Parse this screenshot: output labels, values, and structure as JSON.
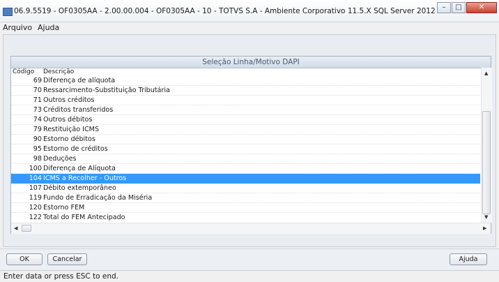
{
  "window": {
    "title": "06.9.5519 - OF0305AA - 2.00.00.004 - OF0305AA - 10 - TOTVS S.A - Ambiente Corporativo 11.5.X SQL Server 2012",
    "minimize_glyph": "–",
    "maximize_glyph": "□",
    "close_glyph": "✕"
  },
  "menu": {
    "items": [
      "Arquivo",
      "Ajuda"
    ]
  },
  "dialog": {
    "title": "Seleção Linha/Motivo DAPI",
    "columns": {
      "code": "Código",
      "desc": "Descrição"
    },
    "rows": [
      {
        "code": "69",
        "desc": "Diferença de alíquota"
      },
      {
        "code": "70",
        "desc": "Ressarcimento-Substituição Tributária"
      },
      {
        "code": "71",
        "desc": "Outros créditos"
      },
      {
        "code": "73",
        "desc": "Créditos transferidos"
      },
      {
        "code": "74",
        "desc": "Outros débitos"
      },
      {
        "code": "79",
        "desc": "Restituição ICMS"
      },
      {
        "code": "90",
        "desc": "Estorno débitos"
      },
      {
        "code": "95",
        "desc": "Estorno de créditos"
      },
      {
        "code": "98",
        "desc": "Deduções"
      },
      {
        "code": "100",
        "desc": "Diferença de Alíquota"
      },
      {
        "code": "104",
        "desc": "ICMS a Recolher - Outros"
      },
      {
        "code": "107",
        "desc": "Débito extemporâneo"
      },
      {
        "code": "119",
        "desc": "Fundo de Erradicação da Miséria"
      },
      {
        "code": "120",
        "desc": "Estorno FEM"
      },
      {
        "code": "122",
        "desc": "Total do FEM Antecipado"
      }
    ],
    "selected_row_index": 10,
    "selection_color": "#3399ff"
  },
  "buttons": {
    "ok": "OK",
    "cancel": "Cancelar",
    "help": "Ajuda"
  },
  "status": {
    "text": "Enter data or press ESC to end."
  }
}
